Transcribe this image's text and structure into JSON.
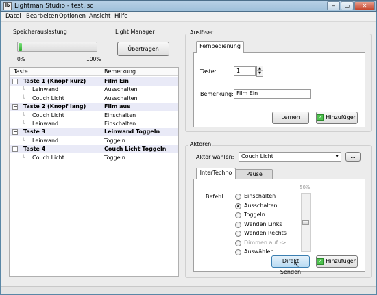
{
  "window": {
    "title": "Lightman Studio - test.lsc",
    "icon_text": "lb",
    "min": "–",
    "max": "▭",
    "close": "✕"
  },
  "menu": [
    "Datei",
    "Bearbeiten",
    "Optionen",
    "Ansicht",
    "Hilfe"
  ],
  "speicher": {
    "label": "Speicherauslastung",
    "min_label": "0%",
    "max_label": "100%",
    "value": 0.04
  },
  "light_manager": {
    "label": "Light Manager",
    "button": "Übertragen"
  },
  "tree": {
    "col_taste": "Taste",
    "col_bemerkung": "Bemerkung",
    "rows": [
      {
        "taste": "Taste 1 (Knopf kurz)",
        "bemerkung": "Film Ein",
        "level": 0
      },
      {
        "taste": "Leinwand",
        "bemerkung": "Ausschalten",
        "level": 1
      },
      {
        "taste": "Couch Licht",
        "bemerkung": "Ausschalten",
        "level": 1
      },
      {
        "taste": "Taste 2 (Knopf lang)",
        "bemerkung": "Film aus",
        "level": 0
      },
      {
        "taste": "Couch Licht",
        "bemerkung": "Einschalten",
        "level": 1
      },
      {
        "taste": "Leinwand",
        "bemerkung": "Einschalten",
        "level": 1
      },
      {
        "taste": "Taste 3",
        "bemerkung": "Leinwand Toggeln",
        "level": 0
      },
      {
        "taste": "Leinwand",
        "bemerkung": "Toggeln",
        "level": 1
      },
      {
        "taste": "Taste 4",
        "bemerkung": "Couch Licht Toggeln",
        "level": 0
      },
      {
        "taste": "Couch Licht",
        "bemerkung": "Toggeln",
        "level": 1
      }
    ]
  },
  "ausloser": {
    "label": "Auslöser",
    "tab": "Fernbedienung",
    "taste_label": "Taste:",
    "taste_value": "1",
    "bemerkung_label": "Bemerkung:",
    "bemerkung_value": "Film Ein",
    "lernen": "Lernen",
    "hinzufugen": "Hinzufügen"
  },
  "aktoren": {
    "label": "Aktoren",
    "aktor_label": "Aktor wählen:",
    "aktor_value": "Couch Licht",
    "more_button": "...",
    "tabs": [
      "InterTechno",
      "Pause"
    ],
    "befehl_label": "Befehl:",
    "options": [
      {
        "label": "Einschalten",
        "selected": false,
        "disabled": false
      },
      {
        "label": "Ausschalten",
        "selected": true,
        "disabled": false
      },
      {
        "label": "Toggeln",
        "selected": false,
        "disabled": false
      },
      {
        "label": "Wenden Links",
        "selected": false,
        "disabled": false
      },
      {
        "label": "Wenden Rechts",
        "selected": false,
        "disabled": false
      },
      {
        "label": "Dimmen auf ->",
        "selected": false,
        "disabled": true
      },
      {
        "label": "Auswählen",
        "selected": false,
        "disabled": false
      }
    ],
    "dim_value": "50%",
    "dim_level": 0.5,
    "direkt_senden": "Direkt Senden",
    "hinzufugen": "Hinzufügen"
  },
  "colors": {
    "accent": "#2fae2f",
    "selection": "#e9eaf7",
    "titlebar": "#9ebfd9"
  }
}
